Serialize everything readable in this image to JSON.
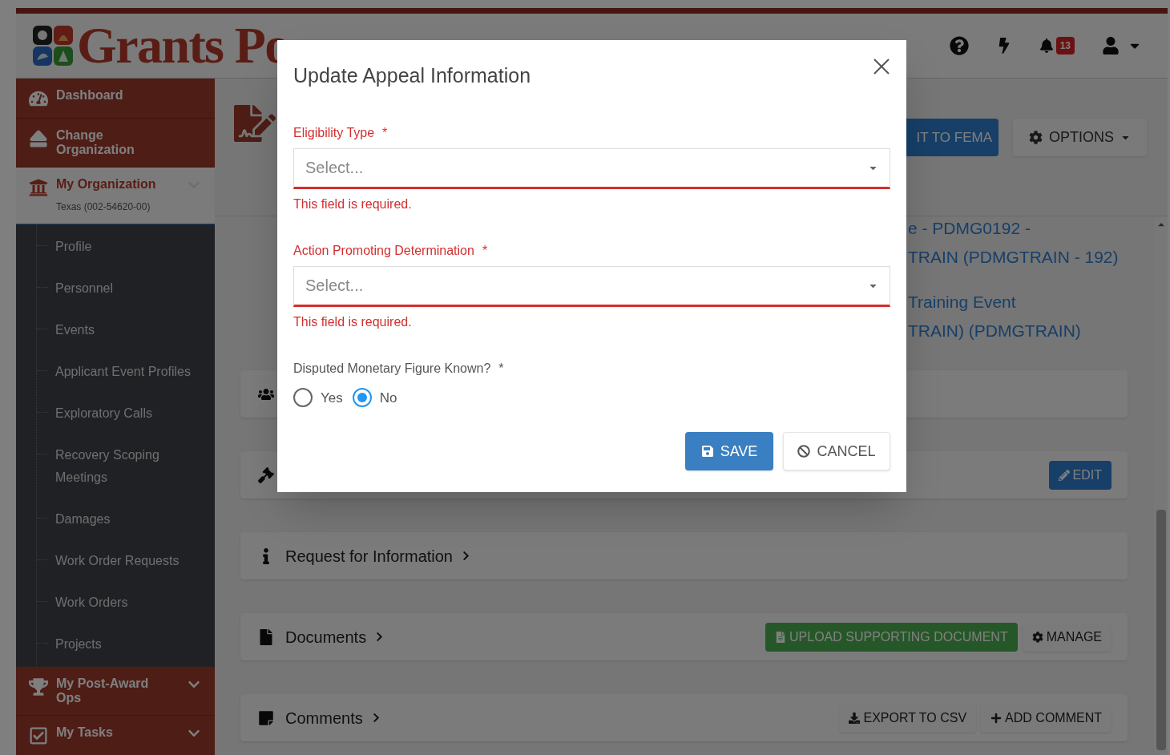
{
  "header": {
    "logo_text": "Grants Po",
    "notification_count": "13"
  },
  "sidebar": {
    "items": [
      {
        "label": "Dashboard",
        "selected": false
      },
      {
        "label": "Change Organization",
        "selected": false
      },
      {
        "label": "My Organization",
        "sublabel": "Texas (002-54620-00)",
        "selected": true,
        "kind": "group",
        "children": [
          {
            "label": "Profile"
          },
          {
            "label": "Personnel"
          },
          {
            "label": "Events"
          },
          {
            "label": "Applicant Event Profiles"
          },
          {
            "label": "Exploratory Calls"
          },
          {
            "label": "Recovery Scoping Meetings"
          },
          {
            "label": "Damages"
          },
          {
            "label": "Work Order Requests"
          },
          {
            "label": "Work Orders"
          },
          {
            "label": "Projects"
          }
        ]
      },
      {
        "label": "My Post-Award Ops",
        "selected": false,
        "kind": "group"
      },
      {
        "label": "My Tasks",
        "selected": false,
        "kind": "group"
      }
    ]
  },
  "toolbar": {
    "buttons": [
      {
        "label": "IT TO FEMA",
        "kind": "primary"
      },
      {
        "label": "OPTIONS",
        "kind": "options"
      }
    ]
  },
  "details": {
    "lines": [
      "e - PDMG0192 -",
      "TRAIN (PDMGTRAIN - 192)",
      "Training Event",
      "TRAIN) (PDMGTRAIN)"
    ]
  },
  "sections": [
    {
      "kind": "people"
    },
    {
      "kind": "gavel",
      "buttons": [
        {
          "label": "EDIT",
          "kind": "edit"
        }
      ]
    },
    {
      "kind": "info",
      "title": "Request for Information"
    },
    {
      "kind": "file",
      "title": "Documents",
      "buttons": [
        {
          "label": "UPLOAD SUPPORTING DOCUMENT",
          "kind": "upload"
        },
        {
          "label": "MANAGE",
          "kind": "manage"
        }
      ]
    },
    {
      "kind": "note",
      "title": "Comments",
      "buttons": [
        {
          "label": "EXPORT TO CSV",
          "kind": "export"
        },
        {
          "label": "ADD COMMENT",
          "kind": "add"
        }
      ]
    }
  ],
  "modal": {
    "title": "Update Appeal Information",
    "fields": [
      {
        "kind": "select",
        "label": "Eligibility Type",
        "required": "*",
        "placeholder": "Select...",
        "invalid": true,
        "error": "This field is required."
      },
      {
        "kind": "select",
        "label": "Action Promoting Determination",
        "required": "*",
        "placeholder": "Select...",
        "invalid": true,
        "error": "This field is required."
      },
      {
        "kind": "radio",
        "label": "Disputed Monetary Figure Known?",
        "required": "*",
        "invalid": false,
        "options": [
          {
            "label": "Yes",
            "selected": false
          },
          {
            "label": "No",
            "selected": true
          }
        ]
      }
    ],
    "buttons": [
      {
        "label": "SAVE",
        "kind": "save"
      },
      {
        "label": "CANCEL",
        "kind": "cancel"
      }
    ]
  }
}
